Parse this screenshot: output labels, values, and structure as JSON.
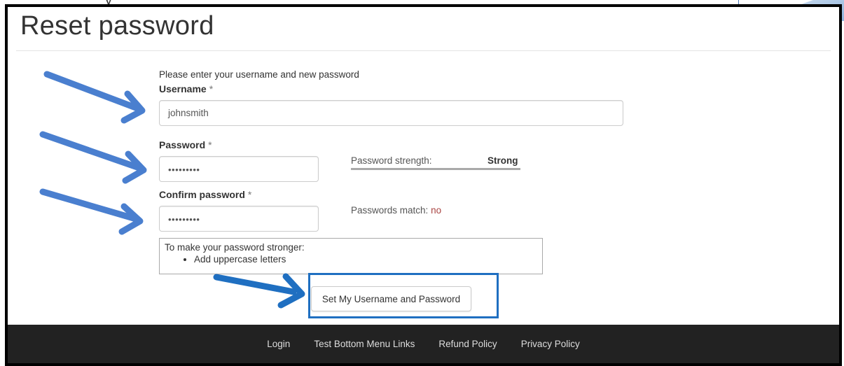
{
  "page": {
    "title": "Reset password",
    "intro": "Please enter your username and new password"
  },
  "form": {
    "username": {
      "label": "Username",
      "required_mark": "*",
      "value": "johnsmith"
    },
    "password": {
      "label": "Password",
      "required_mark": "*",
      "value": "•••••••••"
    },
    "confirm": {
      "label": "Confirm password",
      "required_mark": "*",
      "value": "•••••••••"
    },
    "strength": {
      "label": "Password strength:",
      "value": "Strong"
    },
    "match": {
      "label": "Passwords match:",
      "value": "no"
    },
    "tips": {
      "heading": "To make your password stronger:",
      "items": [
        "Add uppercase letters"
      ]
    },
    "submit_label": "Set My Username and Password"
  },
  "footer": {
    "links": [
      "Login",
      "Test Bottom Menu Links",
      "Refund Policy",
      "Privacy Policy"
    ]
  },
  "colors": {
    "annotation_arrow": "#4a7fcf",
    "highlight_border": "#1f6fc1",
    "match_no": "#a94442",
    "footer_bg": "#222222"
  },
  "annotations": {
    "arrow_icon": "arrow-pointer-icon"
  }
}
